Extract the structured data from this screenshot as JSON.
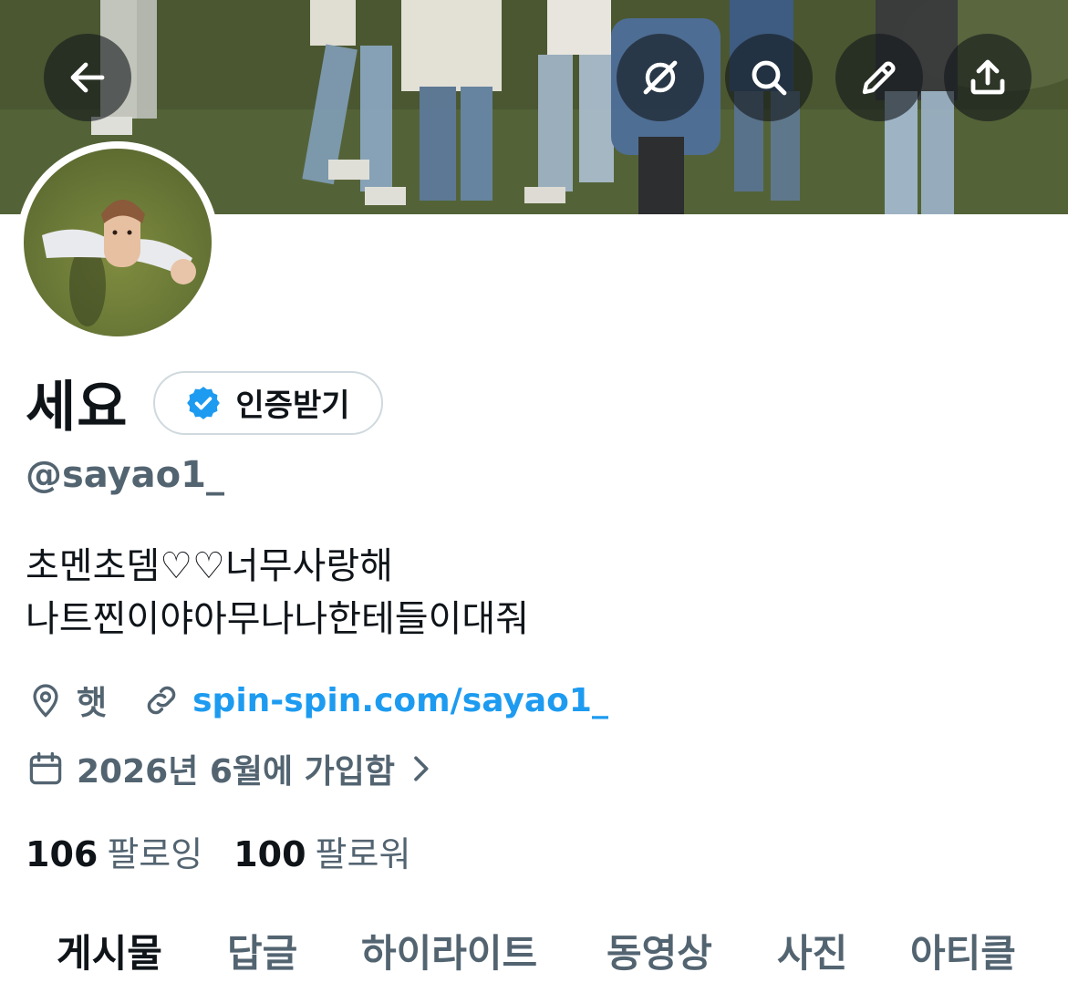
{
  "header": {
    "back_icon": "arrow-left-icon",
    "actions": [
      {
        "icon": "grok-icon"
      },
      {
        "icon": "search-icon"
      },
      {
        "icon": "edit-pencil-icon"
      },
      {
        "icon": "share-upload-icon"
      }
    ]
  },
  "profile": {
    "display_name": "세요",
    "verify_button_label": "인증받기",
    "handle": "@sayao1_",
    "bio_lines": [
      "초멘초뎀♡♡너무사랑해",
      "나트찐이야아무나나한테들이대줘"
    ],
    "location": "햇",
    "website": "spin-spin.com/sayao1_",
    "joined": "2026년 6월에 가입함"
  },
  "stats": {
    "following_count": "106",
    "following_label": "팔로잉",
    "followers_count": "100",
    "followers_label": "팔로워"
  },
  "tabs": [
    {
      "label": "게시물",
      "active": true
    },
    {
      "label": "답글",
      "active": false
    },
    {
      "label": "하이라이트",
      "active": false
    },
    {
      "label": "동영상",
      "active": false
    },
    {
      "label": "사진",
      "active": false
    },
    {
      "label": "아티클",
      "active": false
    }
  ],
  "colors": {
    "accent": "#1d9bf0",
    "secondary_text": "#536471",
    "primary_text": "#0f1419",
    "border": "#cfd9de",
    "verified_badge": "#1d9bf0"
  }
}
